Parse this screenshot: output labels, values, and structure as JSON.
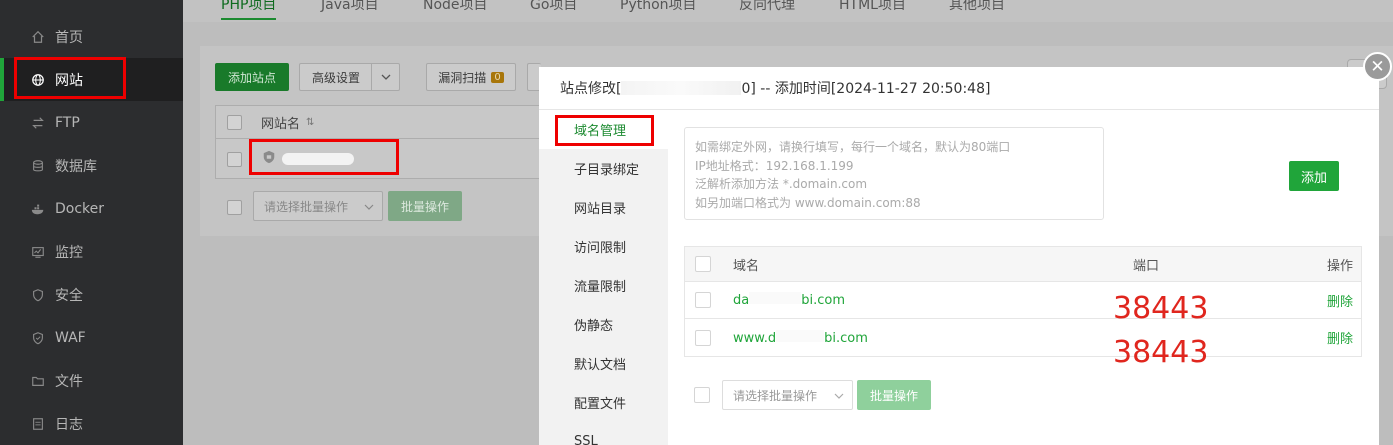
{
  "sidebar": {
    "items": [
      {
        "label": "首页",
        "icon": "home-icon"
      },
      {
        "label": "网站",
        "icon": "globe-icon"
      },
      {
        "label": "FTP",
        "icon": "ftp-icon"
      },
      {
        "label": "数据库",
        "icon": "database-icon"
      },
      {
        "label": "Docker",
        "icon": "docker-icon"
      },
      {
        "label": "监控",
        "icon": "monitor-icon"
      },
      {
        "label": "安全",
        "icon": "shield-icon"
      },
      {
        "label": "WAF",
        "icon": "waf-icon"
      },
      {
        "label": "文件",
        "icon": "folder-icon"
      },
      {
        "label": "日志",
        "icon": "log-icon"
      }
    ],
    "active": "网站"
  },
  "tabs": [
    "PHP项目",
    "Java项目",
    "Node项目",
    "Go项目",
    "Python项目",
    "反向代理",
    "HTML项目",
    "其他项目"
  ],
  "toolbar": {
    "add_site": "添加站点",
    "advanced": "高级设置",
    "vuln_scan": "漏洞扫描",
    "vuln_count": "0"
  },
  "site_table": {
    "col_name": "网站名",
    "batch_select": "请选择批量操作",
    "batch_button": "批量操作"
  },
  "modal": {
    "title_prefix": "站点修改[",
    "title_hidden": "",
    "title_suffix": "0] -- 添加时间[2024-11-27 20:50:48]",
    "menu": [
      "域名管理",
      "子目录绑定",
      "网站目录",
      "访问限制",
      "流量限制",
      "伪静态",
      "默认文档",
      "配置文件",
      "SSL"
    ],
    "active_menu": "域名管理",
    "textarea_hint": [
      "如需绑定外网，请换行填写，每行一个域名，默认为80端口",
      "IP地址格式：192.168.1.199",
      "泛解析添加方法 *.domain.com",
      "如另加端口格式为 www.domain.com:88"
    ],
    "add_button": "添加",
    "table": {
      "col_domain": "域名",
      "col_port": "端口",
      "col_action": "操作",
      "rows": [
        {
          "domain": "da",
          "domain_end": "bi.com",
          "action": "删除"
        },
        {
          "domain": "www.d",
          "domain_end": "bi.com",
          "action": "删除"
        }
      ]
    },
    "batch_select": "请选择批量操作",
    "batch_button": "批量操作"
  },
  "annotations": {
    "port_values": [
      "38443",
      "38443"
    ]
  },
  "colors": {
    "brand_green": "#20a53a",
    "annotation_red": "#ee0000"
  }
}
